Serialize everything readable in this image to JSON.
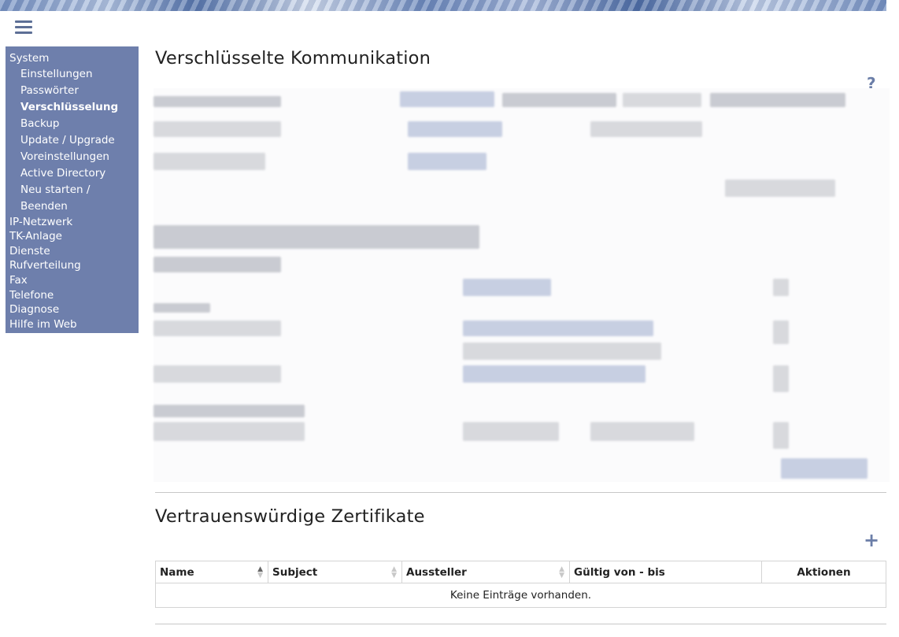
{
  "sidebar": {
    "items": [
      {
        "label": "System",
        "level": "top"
      },
      {
        "label": "Einstellungen",
        "level": "sub"
      },
      {
        "label": "Passwörter",
        "level": "sub"
      },
      {
        "label": "Verschlüsselung",
        "level": "sub",
        "active": true
      },
      {
        "label": "Backup",
        "level": "sub"
      },
      {
        "label": "Update / Upgrade",
        "level": "sub"
      },
      {
        "label": "Voreinstellungen",
        "level": "sub"
      },
      {
        "label": "Active Directory",
        "level": "sub"
      },
      {
        "label": "Neu starten /",
        "level": "sub"
      },
      {
        "label": "Beenden",
        "level": "sub"
      },
      {
        "label": "IP-Netzwerk",
        "level": "top"
      },
      {
        "label": "TK-Anlage",
        "level": "top"
      },
      {
        "label": "Dienste",
        "level": "top"
      },
      {
        "label": "Rufverteilung",
        "level": "top"
      },
      {
        "label": "Fax",
        "level": "top"
      },
      {
        "label": "Telefone",
        "level": "top"
      },
      {
        "label": "Diagnose",
        "level": "top"
      },
      {
        "label": "Hilfe im Web",
        "level": "top"
      }
    ]
  },
  "main": {
    "section1_title": "Verschlüsselte Kommunikation",
    "help_glyph": "?",
    "section2_title": "Vertrauenswürdige Zertifikate",
    "add_glyph": "+",
    "table": {
      "columns": [
        "Name",
        "Subject",
        "Aussteller",
        "Gültig von - bis",
        "Aktionen"
      ],
      "empty_message": "Keine Einträge vorhanden."
    }
  },
  "colors": {
    "sidebar_bg": "#6e7fac",
    "accent": "#6b7ea8"
  },
  "icons": {
    "menu": "hamburger-icon",
    "help": "help-icon",
    "add": "plus-icon",
    "sort": "sort-arrows-icon"
  }
}
